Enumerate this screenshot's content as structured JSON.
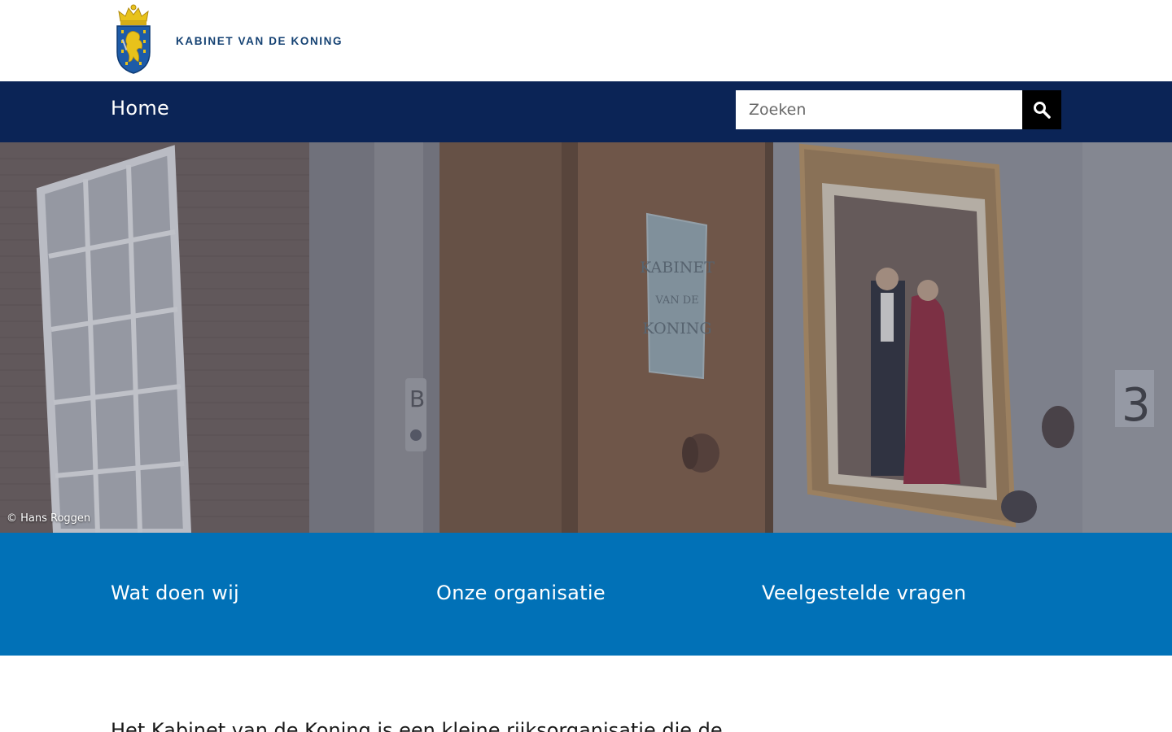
{
  "header": {
    "logo_text": "KABINET VAN DE KONING",
    "logo_icon": "coat-of-arms"
  },
  "nav": {
    "home_label": "Home",
    "search": {
      "placeholder": "Zoeken",
      "value": "",
      "button_icon": "magnifier-icon"
    }
  },
  "hero": {
    "photo_credit": "© Hans Roggen",
    "plaque_lines": [
      "KABINET",
      "VAN DE",
      "KONING"
    ],
    "door_letter": "B",
    "room_number": "3"
  },
  "quick_links": [
    {
      "label": "Wat doen wij"
    },
    {
      "label": "Onze organisatie"
    },
    {
      "label": "Veelgestelde vragen"
    }
  ],
  "intro": {
    "text": "Het Kabinet van de Koning is een kleine rijksorganisatie die de"
  },
  "colors": {
    "nav_bg": "#0b2456",
    "quick_links_bg": "#0171b7",
    "logo_text": "#154273",
    "search_button": "#000000"
  }
}
